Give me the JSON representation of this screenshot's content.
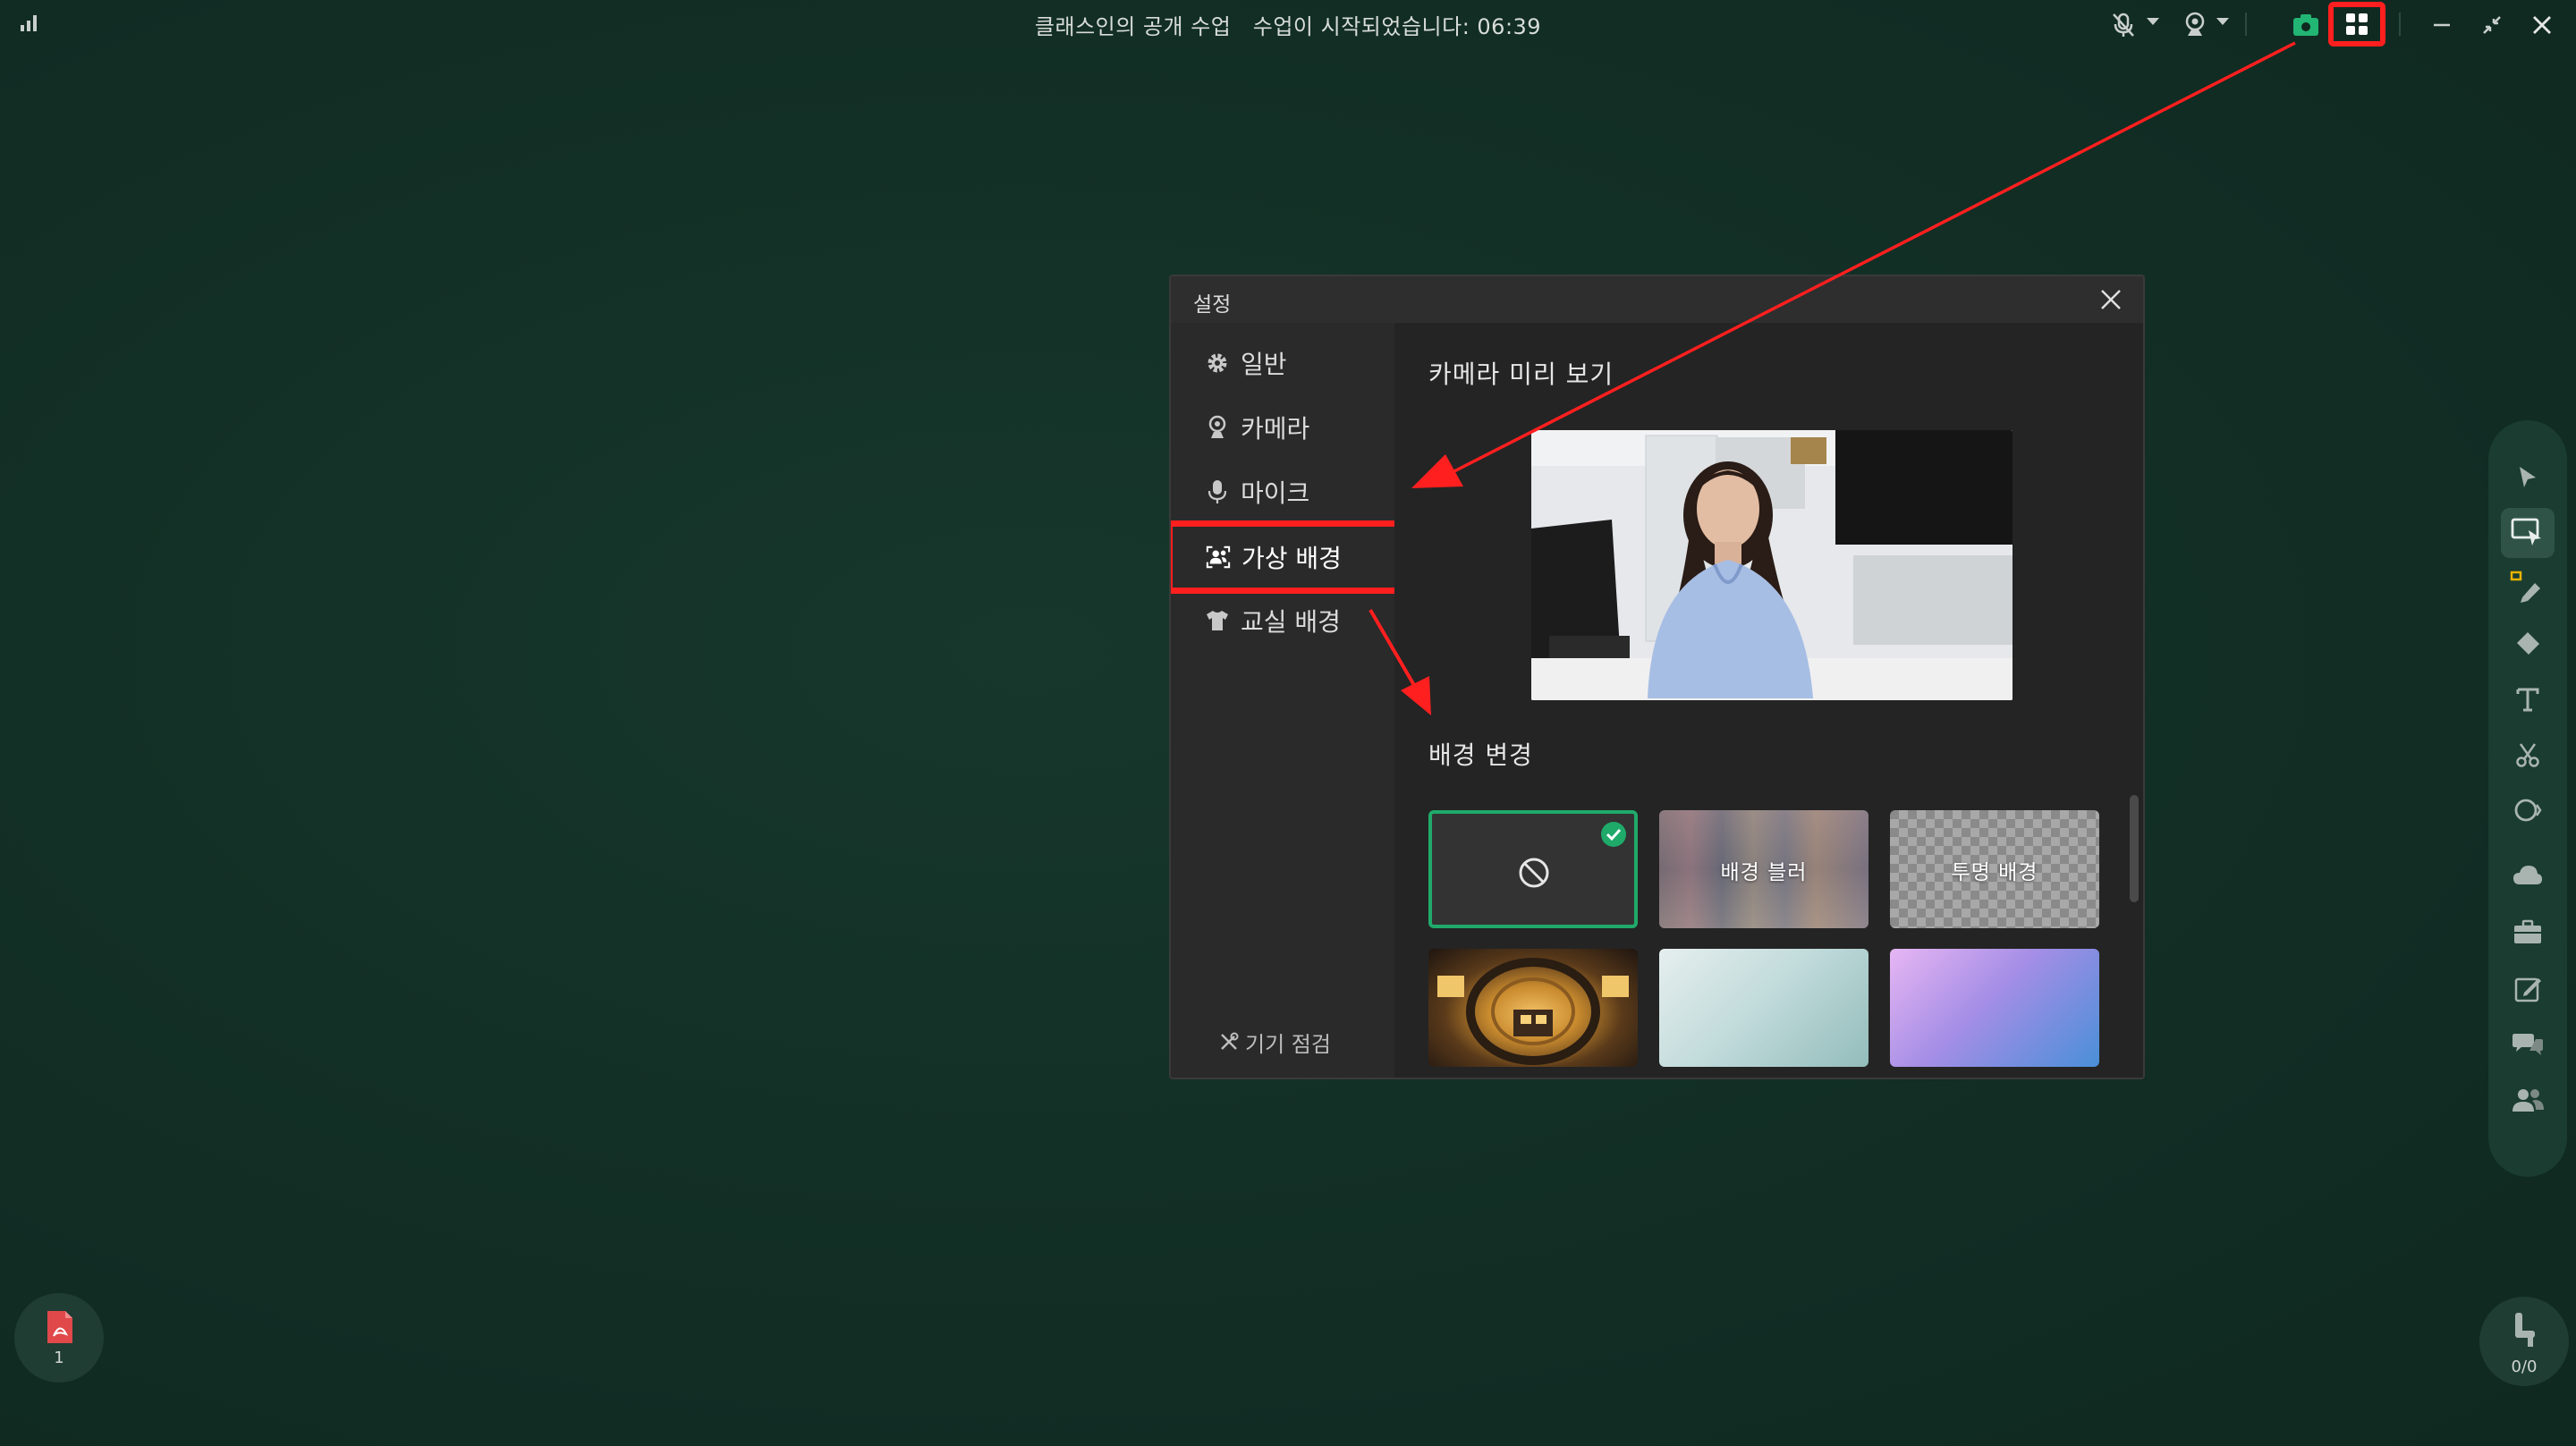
{
  "topbar": {
    "title": "클래스인의 공개 수업   수업이 시작되었습니다: 06:39"
  },
  "dialog": {
    "title": "설정",
    "menu": [
      {
        "label": "일반",
        "icon": "gear-icon"
      },
      {
        "label": "카메라",
        "icon": "webcam-icon"
      },
      {
        "label": "마이크",
        "icon": "microphone-icon"
      },
      {
        "label": "가상 배경",
        "icon": "virtual-background-icon"
      },
      {
        "label": "교실 배경",
        "icon": "shirt-icon"
      }
    ],
    "selected_menu": "가상 배경",
    "device_check": "기기 점검",
    "camera_preview_title": "카메라 미리 보기",
    "change_bg_title": "배경 변경",
    "backgrounds": [
      {
        "label": "",
        "type": "none",
        "selected": true
      },
      {
        "label": "배경 블러",
        "type": "blur"
      },
      {
        "label": "투명 배경",
        "type": "transparent"
      },
      {
        "label": "",
        "type": "image-spaceship"
      },
      {
        "label": "",
        "type": "image-mint-gradient"
      },
      {
        "label": "",
        "type": "image-purple-blue-gradient"
      }
    ]
  },
  "bottom": {
    "pdf_count": "1",
    "seat_count": "0/0"
  },
  "colors": {
    "board_bg": "#133026",
    "highlight_red": "#ff1f1f",
    "selected_green": "#1faa6a",
    "accent_green": "#22b573"
  }
}
